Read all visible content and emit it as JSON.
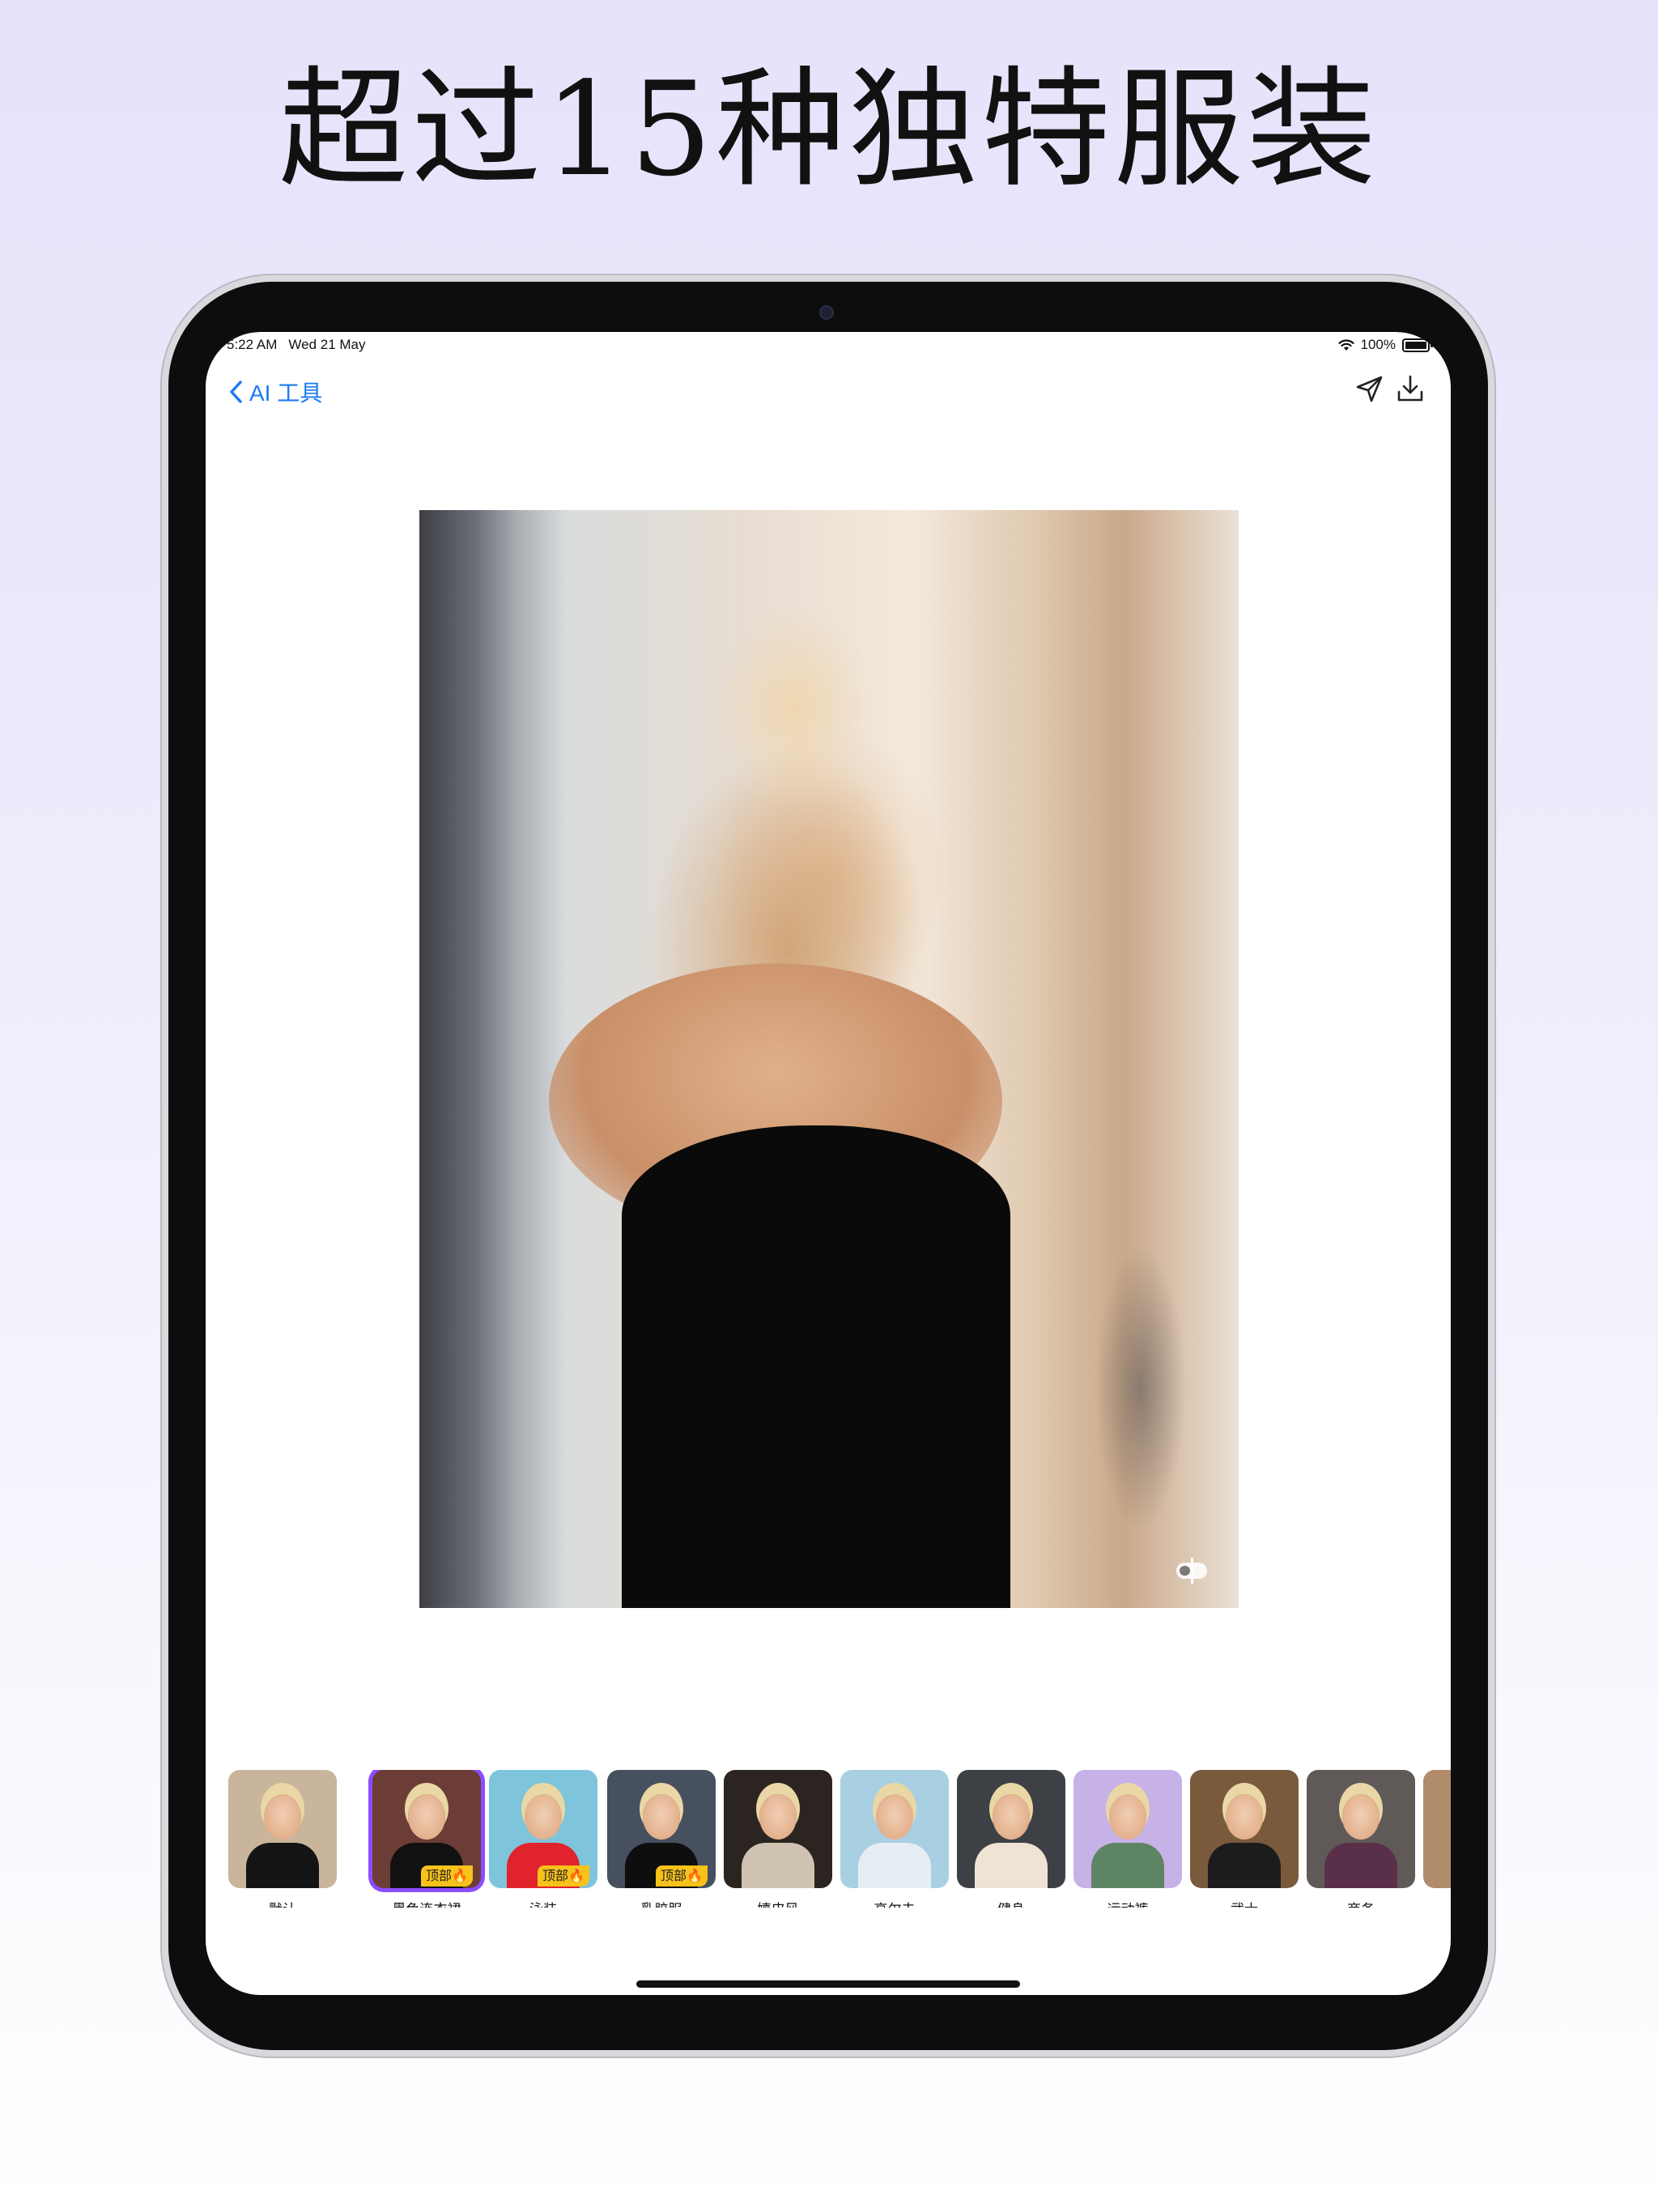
{
  "headline": "超过15种独特服装",
  "status_bar": {
    "time": "5:22 AM",
    "date": "Wed 21 May",
    "battery": "100%"
  },
  "nav": {
    "back_label": "AI 工具",
    "icons": [
      "back-chevron-icon",
      "send-icon",
      "download-icon"
    ]
  },
  "preview": {
    "compare_icon": "compare-icon"
  },
  "outfits": [
    {
      "label": "默认",
      "selected": false,
      "badge": "",
      "bg": "#c9b59b",
      "body": "#141414"
    },
    {
      "label": "黑色连衣裙",
      "selected": true,
      "badge": "顶部🔥",
      "bg": "#6b3d36",
      "body": "#111111"
    },
    {
      "label": "泳装",
      "selected": false,
      "badge": "顶部🔥",
      "bg": "#7ec4da",
      "body": "#e0232d"
    },
    {
      "label": "乳胶服",
      "selected": false,
      "badge": "顶部🔥",
      "bg": "#46505e",
      "body": "#0e0e0e"
    },
    {
      "label": "嬉皮风",
      "selected": false,
      "badge": "",
      "bg": "#2b2421",
      "body": "#cfc4b1"
    },
    {
      "label": "高尔夫",
      "selected": false,
      "badge": "",
      "bg": "#a9cfe2",
      "body": "#e7eef3"
    },
    {
      "label": "健身",
      "selected": false,
      "badge": "",
      "bg": "#3d4045",
      "body": "#efe3d3"
    },
    {
      "label": "运动裤",
      "selected": false,
      "badge": "",
      "bg": "#c6b2e6",
      "body": "#5e8563"
    },
    {
      "label": "武士",
      "selected": false,
      "badge": "",
      "bg": "#7a5a3d",
      "body": "#1c1c1c"
    },
    {
      "label": "商务",
      "selected": false,
      "badge": "",
      "bg": "#5f5a58",
      "body": "#5a2f4a"
    }
  ],
  "colors": {
    "accent": "#1a7cf5",
    "selected_border": "#8b4dff",
    "badge": "#f7c21a"
  }
}
